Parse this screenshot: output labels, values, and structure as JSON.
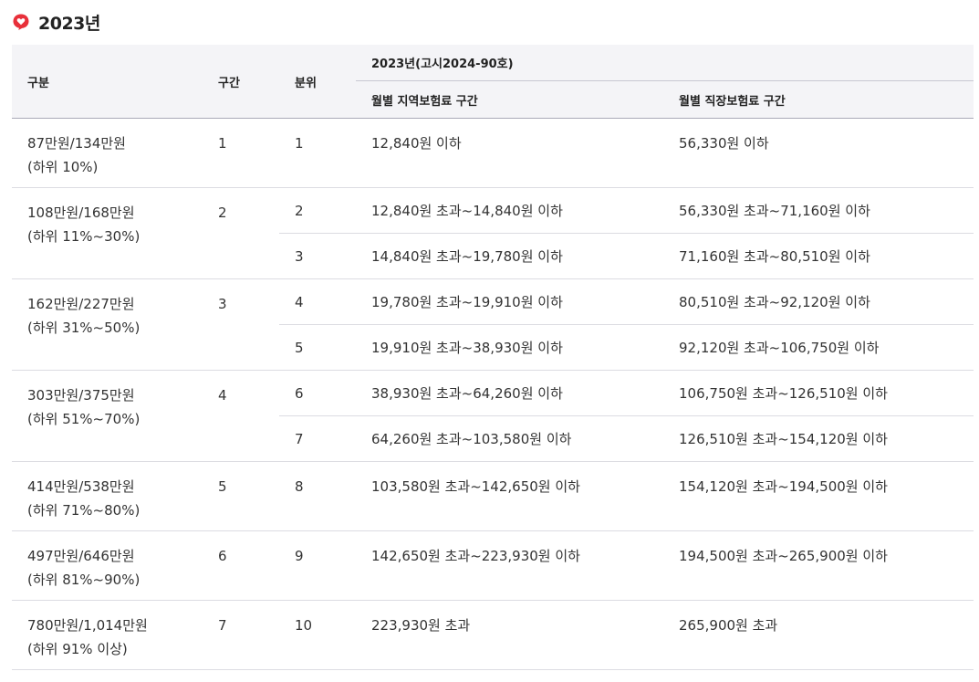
{
  "heading": {
    "icon": "heart-speech-bubble-icon",
    "icon_color": "#e8303a",
    "title": "2023년"
  },
  "table": {
    "headers": {
      "category": "구분",
      "section": "구간",
      "decile": "분위",
      "group": "2023년(고시2024-90호)",
      "regional": "월별 지역보험료 구간",
      "workplace": "월별 직장보험료 구간"
    },
    "groups": [
      {
        "category_line1": "87만원/134만원",
        "category_line2": "(하위 10%)",
        "section": "1",
        "rows": [
          {
            "decile": "1",
            "regional": "12,840원 이하",
            "workplace": "56,330원 이하"
          }
        ]
      },
      {
        "category_line1": "108만원/168만원",
        "category_line2": "(하위 11%~30%)",
        "section": "2",
        "rows": [
          {
            "decile": "2",
            "regional": "12,840원 초과~14,840원 이하",
            "workplace": "56,330원 초과~71,160원 이하"
          },
          {
            "decile": "3",
            "regional": "14,840원 초과~19,780원 이하",
            "workplace": "71,160원 초과~80,510원 이하"
          }
        ]
      },
      {
        "category_line1": "162만원/227만원",
        "category_line2": "(하위 31%~50%)",
        "section": "3",
        "rows": [
          {
            "decile": "4",
            "regional": "19,780원 초과~19,910원 이하",
            "workplace": "80,510원 초과~92,120원 이하"
          },
          {
            "decile": "5",
            "regional": "19,910원 초과~38,930원 이하",
            "workplace": "92,120원 초과~106,750원 이하"
          }
        ]
      },
      {
        "category_line1": "303만원/375만원",
        "category_line2": "(하위 51%~70%)",
        "section": "4",
        "rows": [
          {
            "decile": "6",
            "regional": "38,930원 초과~64,260원 이하",
            "workplace": "106,750원 초과~126,510원 이하"
          },
          {
            "decile": "7",
            "regional": "64,260원 초과~103,580원 이하",
            "workplace": "126,510원 초과~154,120원 이하"
          }
        ]
      },
      {
        "category_line1": "414만원/538만원",
        "category_line2": "(하위 71%~80%)",
        "section": "5",
        "rows": [
          {
            "decile": "8",
            "regional": "103,580원 초과~142,650원 이하",
            "workplace": "154,120원 초과~194,500원 이하"
          }
        ]
      },
      {
        "category_line1": "497만원/646만원",
        "category_line2": "(하위 81%~90%)",
        "section": "6",
        "rows": [
          {
            "decile": "9",
            "regional": "142,650원 초과~223,930원 이하",
            "workplace": "194,500원 초과~265,900원 이하"
          }
        ]
      },
      {
        "category_line1": "780만원/1,014만원",
        "category_line2": "(하위 91% 이상)",
        "section": "7",
        "rows": [
          {
            "decile": "10",
            "regional": "223,930원 초과",
            "workplace": "265,900원 초과"
          }
        ]
      }
    ]
  }
}
